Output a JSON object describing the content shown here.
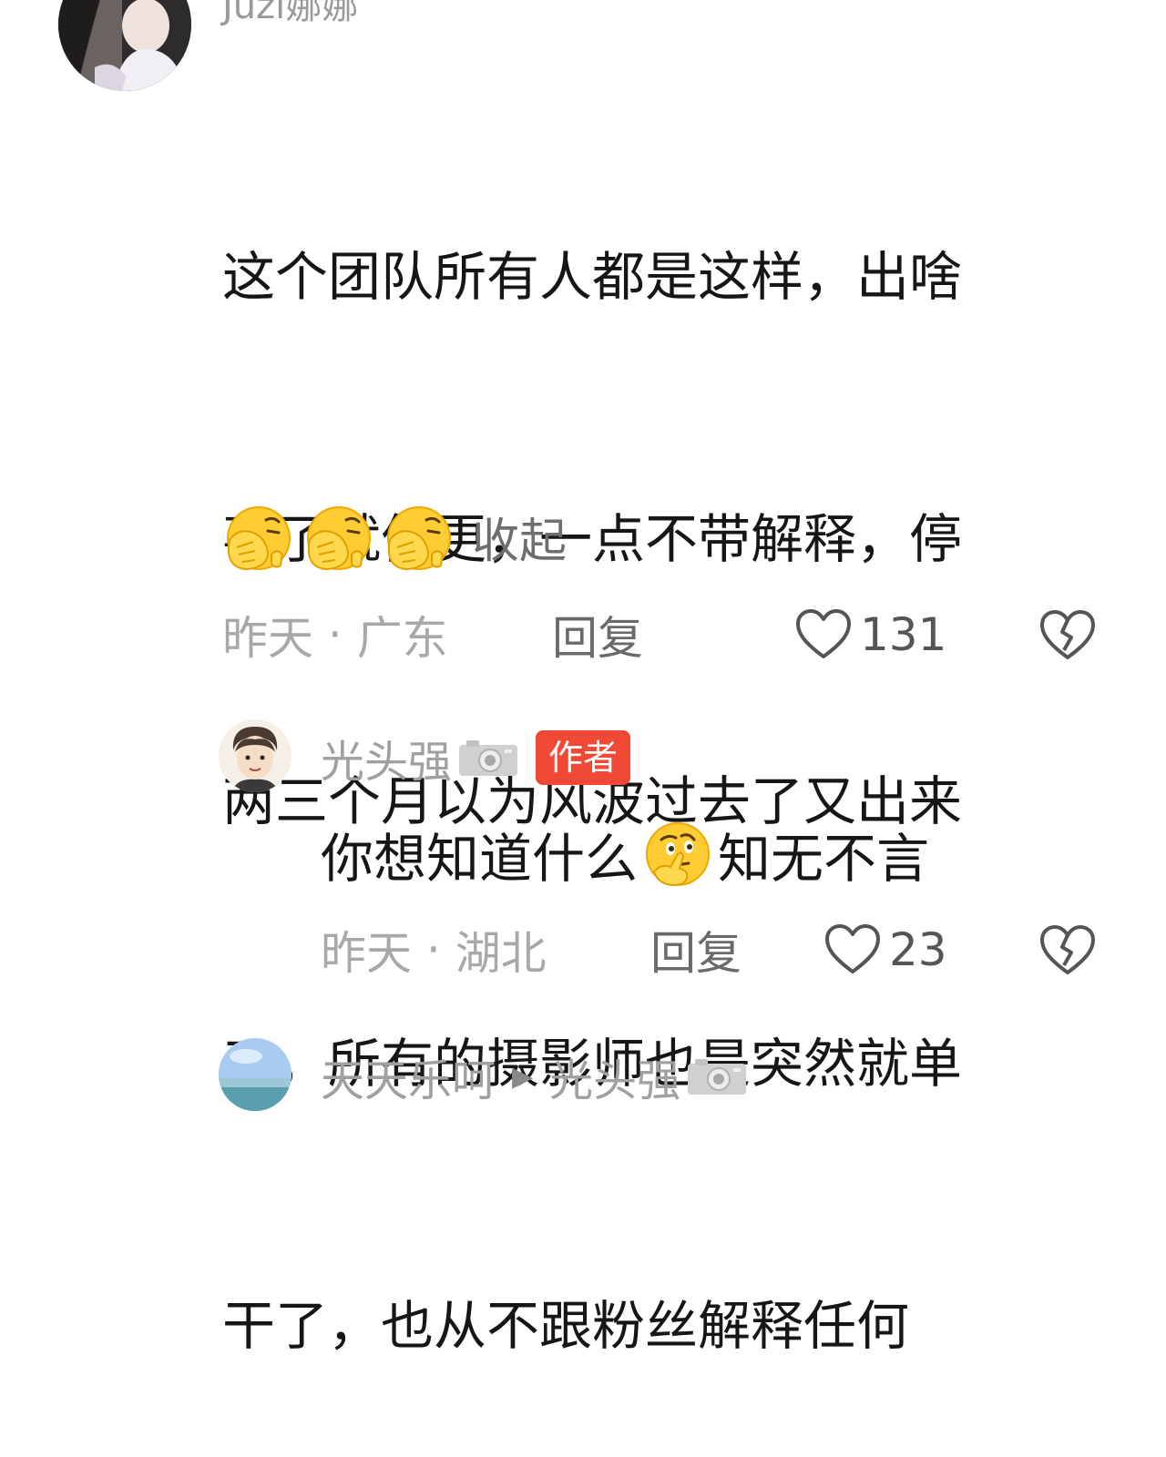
{
  "top_comment": {
    "username": "Juzi娜娜",
    "text_lines": [
      "这个团队所有人都是这样，出啥",
      "事了就停更，一点不带解释，停",
      "两三个月以为风波过去了又出来",
      "了，所有的摄影师也是突然就单",
      "干了，也从不跟粉丝解释任何"
    ],
    "emoji_icons": [
      "facepalm-emoji",
      "facepalm-emoji",
      "facepalm-emoji"
    ],
    "collapse_label": "收起",
    "time": "昨天",
    "location": "广东",
    "separator": " · ",
    "reply_label": "回复",
    "like_count": "131"
  },
  "reply_comment": {
    "username": "光头强",
    "badge_icon": "camera-icon",
    "author_badge": "作者",
    "text_before": "你想知道什么",
    "emoji_icon": "thinking-face-emoji",
    "text_after": "知无不言",
    "time": "昨天",
    "location": "湖北",
    "separator": " · ",
    "reply_label": "回复",
    "like_count": "23"
  },
  "bottom_comment": {
    "username": "天天乐呵",
    "reply_to": "光头强",
    "badge_icon": "camera-icon"
  },
  "colors": {
    "author_badge_bg": "#f04a36",
    "meta_text": "#a8a8a8",
    "body_text": "#161616"
  }
}
